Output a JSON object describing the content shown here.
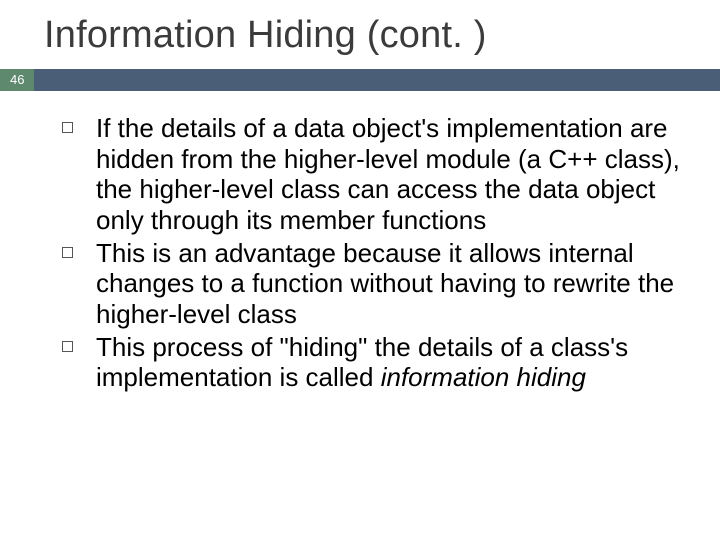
{
  "slide": {
    "title": "Information Hiding (cont. )",
    "page_number": "46",
    "bullets": [
      {
        "text_html": "If the details of a data object's implementation are hidden from the higher-level module (a C++ class), the higher-level class can access the data object only through its member functions"
      },
      {
        "text_html": "This is an advantage because it allows internal changes to a function without having to rewrite the higher-level class"
      },
      {
        "text_html": "This process of \"hiding\" the details of a class's implementation is called <span class=\"italic\">information hiding</span>"
      }
    ]
  }
}
